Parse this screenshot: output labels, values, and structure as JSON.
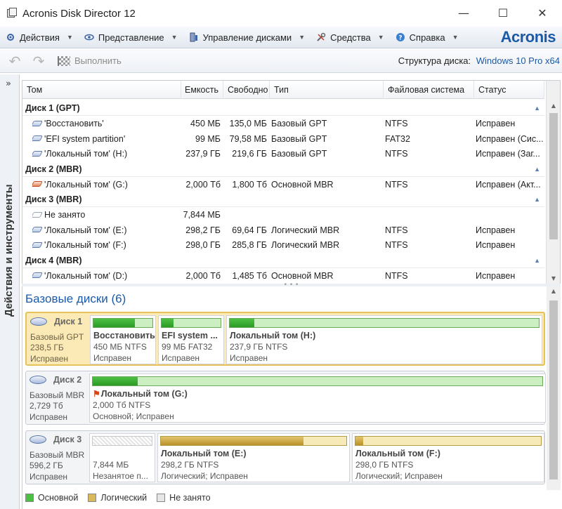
{
  "window": {
    "title": "Acronis Disk Director 12",
    "min": "—",
    "max": "☐",
    "close": "✕"
  },
  "menu": {
    "items": [
      {
        "label": "Действия",
        "icon": "actions-icon"
      },
      {
        "label": "Представление",
        "icon": "eye-icon"
      },
      {
        "label": "Управление дисками",
        "icon": "disk-manage-icon"
      },
      {
        "label": "Средства",
        "icon": "tools-icon"
      },
      {
        "label": "Справка",
        "icon": "help-icon"
      }
    ],
    "brand": "Acronis"
  },
  "toolbar": {
    "undo": "↶",
    "redo": "↷",
    "execute_label": "Выполнить",
    "structure_label": "Структура диска:",
    "structure_value": "Windows 10 Pro x64"
  },
  "side_panel": {
    "label": "Действия и инструменты",
    "expand": "»"
  },
  "table": {
    "columns": [
      "Том",
      "Емкость",
      "Свободно",
      "Тип",
      "Файловая система",
      "Статус"
    ],
    "groups": [
      {
        "name": "Диск 1 (GPT)",
        "rows": [
          {
            "icon": "volume",
            "name": "'Восстановить'",
            "cap": "450 МБ",
            "free": "135,0 МБ",
            "type": "Базовый GPT",
            "fs": "NTFS",
            "status": "Исправен"
          },
          {
            "icon": "volume",
            "name": "'EFI system partition'",
            "cap": "99 МБ",
            "free": "79,58 МБ",
            "type": "Базовый GPT",
            "fs": "FAT32",
            "status": "Исправен (Сис..."
          },
          {
            "icon": "volume",
            "name": "'Локальный том' (H:)",
            "cap": "237,9 ГБ",
            "free": "219,6 ГБ",
            "type": "Базовый GPT",
            "fs": "NTFS",
            "status": "Исправен (Заг..."
          }
        ]
      },
      {
        "name": "Диск 2 (MBR)",
        "rows": [
          {
            "icon": "active",
            "name": "'Локальный том' (G:)",
            "cap": "2,000 Тб",
            "free": "1,800 Тб",
            "type": "Основной MBR",
            "fs": "NTFS",
            "status": "Исправен (Акт..."
          }
        ]
      },
      {
        "name": "Диск 3 (MBR)",
        "rows": [
          {
            "icon": "free",
            "name": "Не занято",
            "cap": "7,844 МБ",
            "free": "",
            "type": "",
            "fs": "",
            "status": ""
          },
          {
            "icon": "volume",
            "name": "'Локальный том' (E:)",
            "cap": "298,2 ГБ",
            "free": "69,64 ГБ",
            "type": "Логический MBR",
            "fs": "NTFS",
            "status": "Исправен"
          },
          {
            "icon": "volume",
            "name": "'Локальный том' (F:)",
            "cap": "298,0 ГБ",
            "free": "285,8 ГБ",
            "type": "Логический MBR",
            "fs": "NTFS",
            "status": "Исправен"
          }
        ]
      },
      {
        "name": "Диск 4 (MBR)",
        "rows": [
          {
            "icon": "volume",
            "name": "'Локальный том' (D:)",
            "cap": "2,000 Тб",
            "free": "1,485 Тб",
            "type": "Основной MBR",
            "fs": "NTFS",
            "status": "Исправен"
          }
        ]
      }
    ]
  },
  "disks_panel": {
    "title": "Базовые диски (6)",
    "disks": [
      {
        "name": "Диск 1",
        "type": "Базовый GPT",
        "size": "238,5 ГБ",
        "status": "Исправен",
        "selected": true,
        "partitions": [
          {
            "name": "Восстановить",
            "size": "450 МБ NTFS",
            "status": "Исправен",
            "kind": "primary",
            "used": 0.7
          },
          {
            "name": "EFI system ...",
            "size": "99 МБ FAT32",
            "status": "Исправен",
            "kind": "primary",
            "used": 0.2
          },
          {
            "name": "Локальный том (H:)",
            "size": "237,9 ГБ NTFS",
            "status": "Исправен",
            "kind": "primary",
            "used": 0.08
          }
        ]
      },
      {
        "name": "Диск 2",
        "type": "Базовый MBR",
        "size": "2,729 Тб",
        "status": "Исправен",
        "selected": false,
        "partitions": [
          {
            "name": "Локальный том (G:)",
            "size": "2,000 Тб NTFS",
            "status": "Основной; Исправен",
            "kind": "primary",
            "used": 0.1,
            "active": true
          }
        ]
      },
      {
        "name": "Диск 3",
        "type": "Базовый MBR",
        "size": "596,2 ГБ",
        "status": "Исправен",
        "selected": false,
        "partitions": [
          {
            "name": "",
            "size": "7,844 МБ",
            "status": "Незанятое п...",
            "kind": "free",
            "used": 0
          },
          {
            "name": "Локальный том (E:)",
            "size": "298,2 ГБ NTFS",
            "status": "Логический; Исправен",
            "kind": "logical",
            "used": 0.77
          },
          {
            "name": "Локальный том (F:)",
            "size": "298,0 ГБ NTFS",
            "status": "Логический; Исправен",
            "kind": "logical",
            "used": 0.04
          }
        ]
      }
    ],
    "legend": [
      {
        "label": "Основной",
        "color": "#4cc043"
      },
      {
        "label": "Логический",
        "color": "#d9b95c"
      },
      {
        "label": "Не занято",
        "color": "#e6e6e6"
      }
    ]
  }
}
